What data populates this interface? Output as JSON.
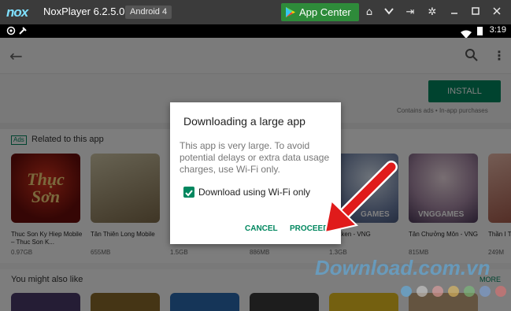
{
  "titlebar": {
    "logo": "nox",
    "title": "NoxPlayer 6.2.5.0",
    "android_badge": "Android 4",
    "app_center_label": "App Center"
  },
  "statusbar": {
    "time": "3:19"
  },
  "store": {
    "install_label": "INSTALL",
    "contains_ads": "Contains ads • In-app purchases",
    "ads_badge": "Ads",
    "related_title": "Related to this app",
    "related_apps": [
      {
        "name": "Thuc Son Ky Hiep Mobile – Thuc Son K...",
        "size": "0.97GB"
      },
      {
        "name": "Tân Thiên Long Mobile",
        "size": "655MB"
      },
      {
        "name": "",
        "size": "1.5GB"
      },
      {
        "name": "",
        "size": "886MB"
      },
      {
        "name": "Awaken - VNG",
        "size": "1.3GB"
      },
      {
        "name": "Tân Chưởng Môn - VNG",
        "size": "815MB"
      },
      {
        "name": "Thần I Ten",
        "size": "249M"
      }
    ],
    "maylike_title": "You might also like",
    "more_label": "MORE"
  },
  "dialog": {
    "title": "Downloading a large app",
    "message": "This app is very large. To avoid potential delays or extra data usage charges, use Wi-Fi only.",
    "checkbox_label": "Download using Wi-Fi only",
    "checkbox_checked": true,
    "cancel_label": "CANCEL",
    "proceed_label": "PROCEED"
  },
  "thumb_text": {
    "app1_title": "Thục Sơn",
    "app5_label": "GAMES",
    "app6_label": "VNGGAMES"
  },
  "watermark": "Download.com.vn",
  "colors": {
    "accent": "#01875f",
    "nox_bar": "#3b3b3b",
    "app_center": "#2e8b3a",
    "arrow": "#e01b1b"
  }
}
